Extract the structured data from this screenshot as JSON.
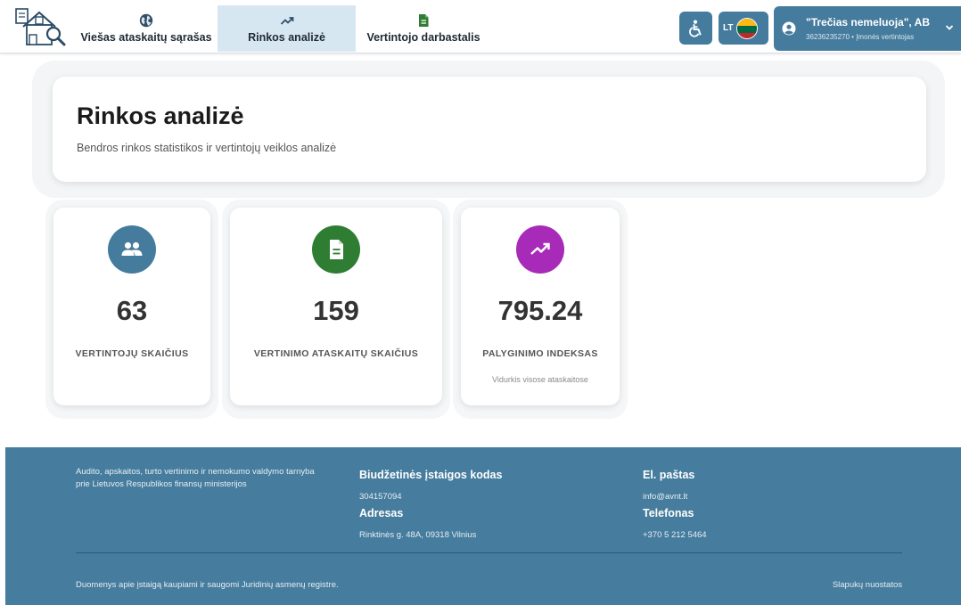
{
  "header": {
    "tabs": [
      {
        "label": "Viešas ataskaitų sąrašas",
        "icon": "globe-icon",
        "active": false
      },
      {
        "label": "Rinkos analizė",
        "icon": "trending-up-icon",
        "active": true
      },
      {
        "label": "Vertintojo darbastalis",
        "icon": "document-icon",
        "active": false
      }
    ],
    "language": "LT",
    "user": {
      "name": "\"Trečias nemeluoja\", AB",
      "details": "36236235270 • Įmonės vertintojas"
    }
  },
  "page": {
    "title": "Rinkos analizė",
    "subtitle": "Bendros rinkos statistikos ir vertintojų veiklos analizė"
  },
  "stats": [
    {
      "value": "63",
      "label": "VERTINTOJŲ SKAIČIUS",
      "icon": "users-icon",
      "color": "#457b9d"
    },
    {
      "value": "159",
      "label": "VERTINIMO ATASKAITŲ SKAIČIUS",
      "icon": "document-icon",
      "color": "#2e7d32"
    },
    {
      "value": "795.24",
      "label": "PALYGINIMO INDEKSAS",
      "note": "Vidurkis visose ataskaitose",
      "icon": "trending-up-icon",
      "color": "#a82ab8"
    }
  ],
  "footer": {
    "org": "Audito, apskaitos, turto vertinimo ir nemokumo valdymo tarnyba prie Lietuvos Respublikos finansų ministerijos",
    "budget_code_label": "Biudžetinės įstaigos kodas",
    "budget_code": "304157094",
    "address_label": "Adresas",
    "address": "Rinktinės g. 48A, 09318 Vilnius",
    "email_label": "El. paštas",
    "email": "info@avnt.lt",
    "phone_label": "Telefonas",
    "phone": "+370 5 212 5464",
    "registry_note": "Duomenys apie įstaigą kaupiami ir saugomi Juridinių asmenų registre.",
    "cookies": "Slapukų nuostatos"
  },
  "colors": {
    "primary": "#457b9d",
    "active_tab": "#d7e7f2",
    "footer": "#467c9d",
    "green": "#2e7d32",
    "purple": "#a82ab8"
  }
}
